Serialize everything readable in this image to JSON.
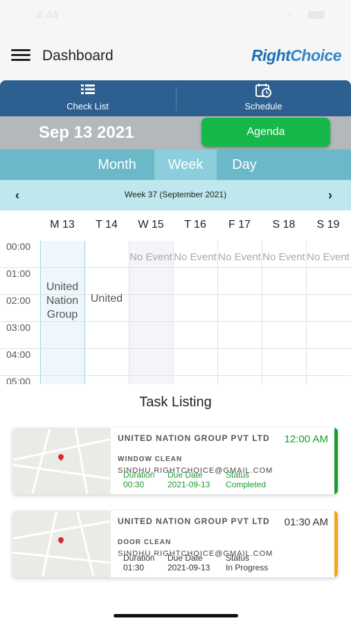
{
  "status_bar": {
    "time": "4:44"
  },
  "header": {
    "menu_icon": "hamburger-icon",
    "title": "Dashboard",
    "brand_prefix": "Right",
    "brand_suffix": "Choice"
  },
  "tabs": [
    {
      "label": "Check List",
      "icon": "checklist-icon"
    },
    {
      "label": "Schedule",
      "icon": "calendar-clock-icon"
    }
  ],
  "date_bar": {
    "date": "Sep 13 2021",
    "agenda_label": "Agenda"
  },
  "view_modes": {
    "items": [
      "Month",
      "Week",
      "Day"
    ],
    "active": "Week"
  },
  "week_nav": {
    "label": "Week 37 (September 2021)",
    "prev_icon": "chevron-left-icon",
    "next_icon": "chevron-right-icon"
  },
  "days": [
    "M 13",
    "T 14",
    "W 15",
    "T 16",
    "F 17",
    "S 18",
    "S 19"
  ],
  "hours": [
    "00:00",
    "01:00",
    "02:00",
    "03:00",
    "04:00",
    "05:00"
  ],
  "events": {
    "mon": "United Nation Group",
    "tue": "United",
    "no_event": "No Event"
  },
  "task_section": {
    "title": "Task Listing"
  },
  "tasks": [
    {
      "company": "UNITED NATION GROUP PVT LTD",
      "task": "WINDOW CLEAN",
      "email": "SINDHU.RIGHTCHOICE@GMAIL.COM",
      "duration_label": "Duration",
      "duration": "00:30",
      "due_label": "Due Date",
      "due": "2021-09-13",
      "status_label": "Status",
      "status": "Completed",
      "time": "12:00 AM",
      "accent": "#1a9c2e"
    },
    {
      "company": "UNITED NATION GROUP PVT LTD",
      "task": "DOOR CLEAN",
      "email": "SINDHU.RIGHTCHOICE@GMAIL.COM",
      "duration_label": "Duration",
      "duration": "01:30",
      "due_label": "Due Date",
      "due": "2021-09-13",
      "status_label": "Status",
      "status": "In Progress",
      "time": "01:30 AM",
      "accent": "#f2a71b"
    }
  ],
  "colors": {
    "primary": "#2d5f90",
    "agenda": "#16b84a",
    "segment": "#6bb8c8",
    "week_bar": "#bfe7ee"
  }
}
